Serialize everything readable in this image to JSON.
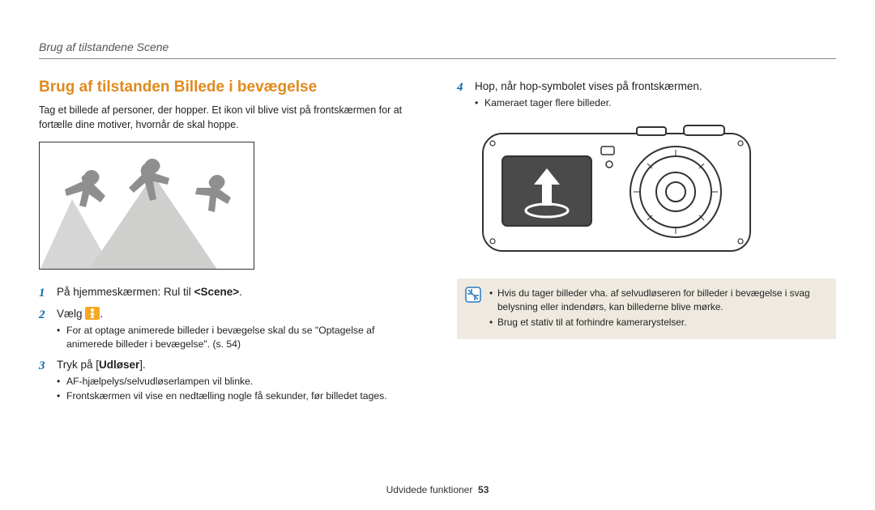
{
  "header": {
    "running_head": "Brug af tilstandene Scene"
  },
  "left": {
    "title": "Brug af tilstanden Billede i bevægelse",
    "intro": "Tag et billede af personer, der hopper. Et ikon vil blive vist på frontskærmen for at fortælle dine motiver, hvornår de skal hoppe.",
    "steps": {
      "s1": {
        "num": "1",
        "text_pre": "På hjemmeskærmen: Rul til ",
        "scene": "<Scene>",
        "text_post": "."
      },
      "s2": {
        "num": "2",
        "text": "Vælg ",
        "dot": ".",
        "bullets": [
          "For at optage animerede billeder i bevægelse skal du se \"Optagelse af animerede billeder i bevægelse\". (s. 54)"
        ]
      },
      "s3": {
        "num": "3",
        "text_pre": "Tryk på [",
        "udloser": "Udløser",
        "text_post": "].",
        "bullets": [
          "AF-hjælpelys/selvudløserlampen vil blinke.",
          "Frontskærmen vil vise en nedtælling nogle få sekunder, før billedet tages."
        ]
      }
    }
  },
  "right": {
    "steps": {
      "s4": {
        "num": "4",
        "text": "Hop, når hop-symbolet vises på frontskærmen.",
        "bullets": [
          "Kameraet tager flere billeder."
        ]
      }
    },
    "note": {
      "items": [
        "Hvis du tager billeder vha. af selvudløseren for billeder i bevægelse i svag belysning eller indendørs, kan billederne blive mørke.",
        "Brug et stativ til at forhindre kamerarystelser."
      ]
    }
  },
  "footer": {
    "section": "Udvidede funktioner",
    "page": "53"
  }
}
